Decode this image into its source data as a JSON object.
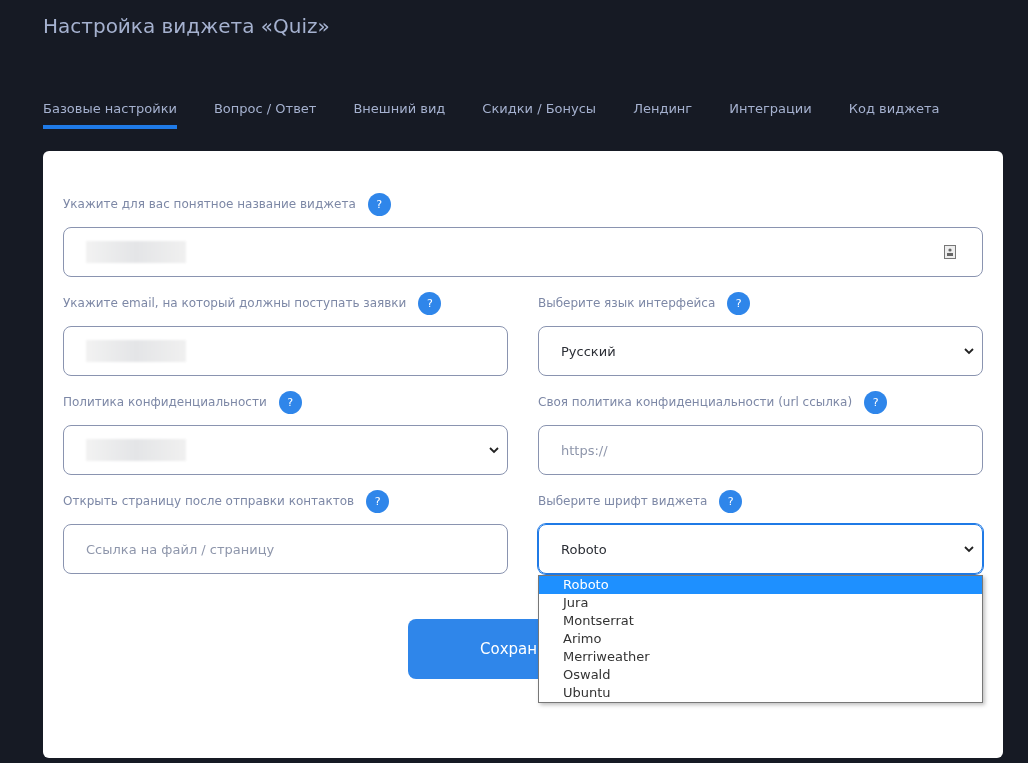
{
  "title": "Настройка виджета «Quiz»",
  "tabs": [
    {
      "label": "Базовые настройки",
      "selected": true
    },
    {
      "label": "Вопрос / Ответ",
      "selected": false
    },
    {
      "label": "Внешний вид",
      "selected": false
    },
    {
      "label": "Скидки / Бонусы",
      "selected": false
    },
    {
      "label": "Лендинг",
      "selected": false
    },
    {
      "label": "Интеграции",
      "selected": false
    },
    {
      "label": "Код виджета",
      "selected": false
    }
  ],
  "fields": [
    {
      "label": "Укажите для вас понятное название виджета",
      "kind": "text",
      "wide": true,
      "redacted": true,
      "has_card_icon": true
    },
    {
      "label": "Укажите email, на который должны поступать заявки",
      "kind": "text",
      "wide": false,
      "redacted": true
    },
    {
      "label": "Выберите язык интерфейса",
      "kind": "select",
      "wide": false,
      "value": "Русский",
      "focused": false
    },
    {
      "label": "Политика конфиденциальности",
      "kind": "select",
      "wide": false,
      "redacted": true,
      "focused": false
    },
    {
      "label": "Своя политика конфиденциальности (url ссылка)",
      "kind": "text",
      "wide": false,
      "placeholder": "https://"
    },
    {
      "label": "Открыть страницу после отправки контактов",
      "kind": "text",
      "wide": false,
      "placeholder": "Ссылка на файл / страницу"
    },
    {
      "label": "Выберите шрифт виджета",
      "kind": "select",
      "wide": false,
      "value": "Roboto",
      "focused": true,
      "options": [
        {
          "label": "Roboto",
          "selected": true
        },
        {
          "label": "Jura",
          "selected": false
        },
        {
          "label": "Montserrat",
          "selected": false
        },
        {
          "label": "Arimo",
          "selected": false
        },
        {
          "label": "Merriweather",
          "selected": false
        },
        {
          "label": "Oswald",
          "selected": false
        },
        {
          "label": "Ubuntu",
          "selected": false
        }
      ]
    }
  ],
  "help_glyph": "?",
  "save_button": "Сохран"
}
